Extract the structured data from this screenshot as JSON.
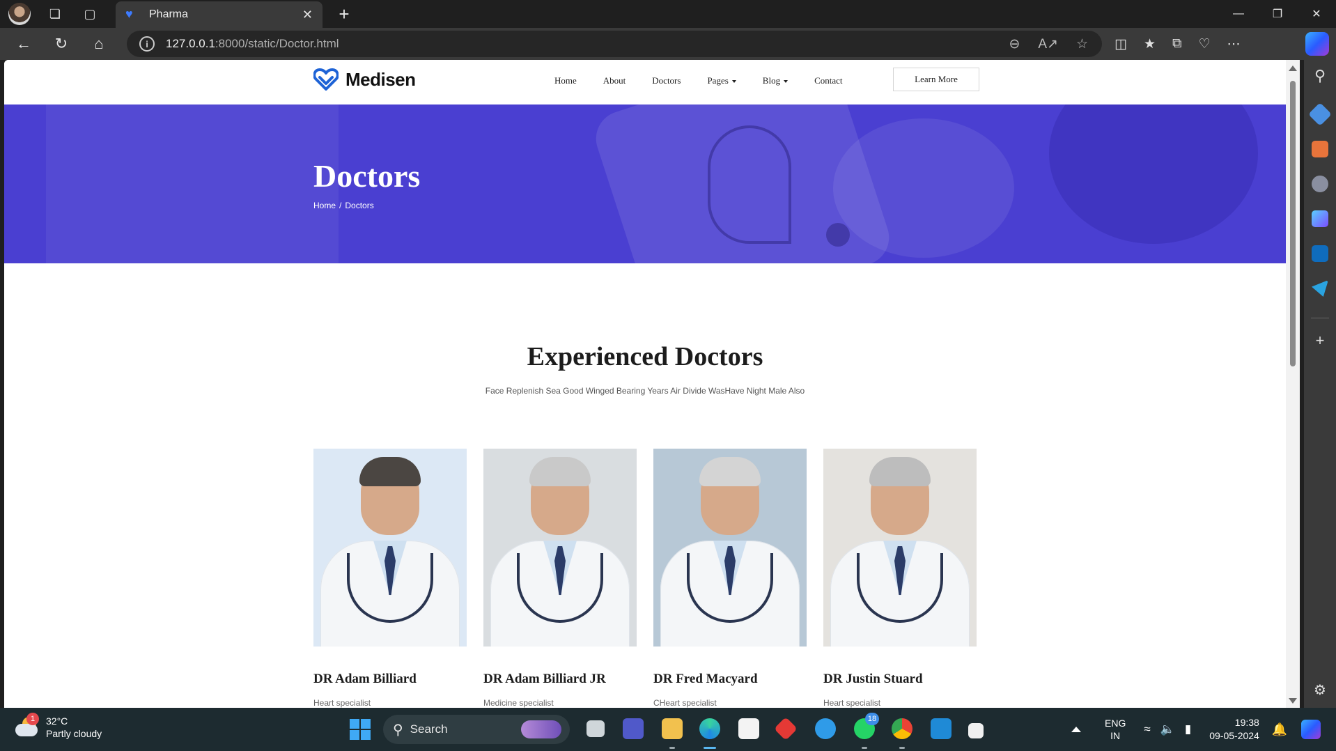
{
  "browser": {
    "tab_title": "Pharma",
    "url_host": "127.0.0.1",
    "url_path": ":8000/static/Doctor.html"
  },
  "site": {
    "brand": "Medisen",
    "menu": [
      {
        "label": "Home",
        "dropdown": false
      },
      {
        "label": "About",
        "dropdown": false
      },
      {
        "label": "Doctors",
        "dropdown": false
      },
      {
        "label": "Pages",
        "dropdown": true
      },
      {
        "label": "Blog",
        "dropdown": true
      },
      {
        "label": "Contact",
        "dropdown": false
      }
    ],
    "cta_label": "Learn More",
    "brand_color": "#4a3fd1"
  },
  "hero": {
    "title": "Doctors",
    "breadcrumb": {
      "home": "Home",
      "separator": "/",
      "current": "Doctors"
    }
  },
  "section": {
    "title": "Experienced Doctors",
    "subtitle": "Face Replenish Sea Good Winged Bearing Years Air Divide WasHave Night Male Also"
  },
  "doctors": [
    {
      "name": "DR Adam Billiard",
      "role": "Heart specialist",
      "bg": "#dce8f5",
      "hair": "#4b4642"
    },
    {
      "name": "DR Adam Billiard JR",
      "role": "Medicine specialist",
      "bg": "#d9dde0",
      "hair": "#c9c9c9"
    },
    {
      "name": "DR Fred Macyard",
      "role": "CHeart specialist",
      "bg": "#b7c8d6",
      "hair": "#d4d4d4"
    },
    {
      "name": "DR Justin Stuard",
      "role": "Heart specialist",
      "bg": "#e4e2de",
      "hair": "#bdbdbd"
    }
  ],
  "taskbar": {
    "weather_temp": "32°C",
    "weather_desc": "Partly cloudy",
    "weather_badge": "1",
    "search_label": "Search",
    "whatsapp_badge": "18",
    "lang_top": "ENG",
    "lang_bottom": "IN",
    "time": "19:38",
    "date": "09-05-2024"
  }
}
